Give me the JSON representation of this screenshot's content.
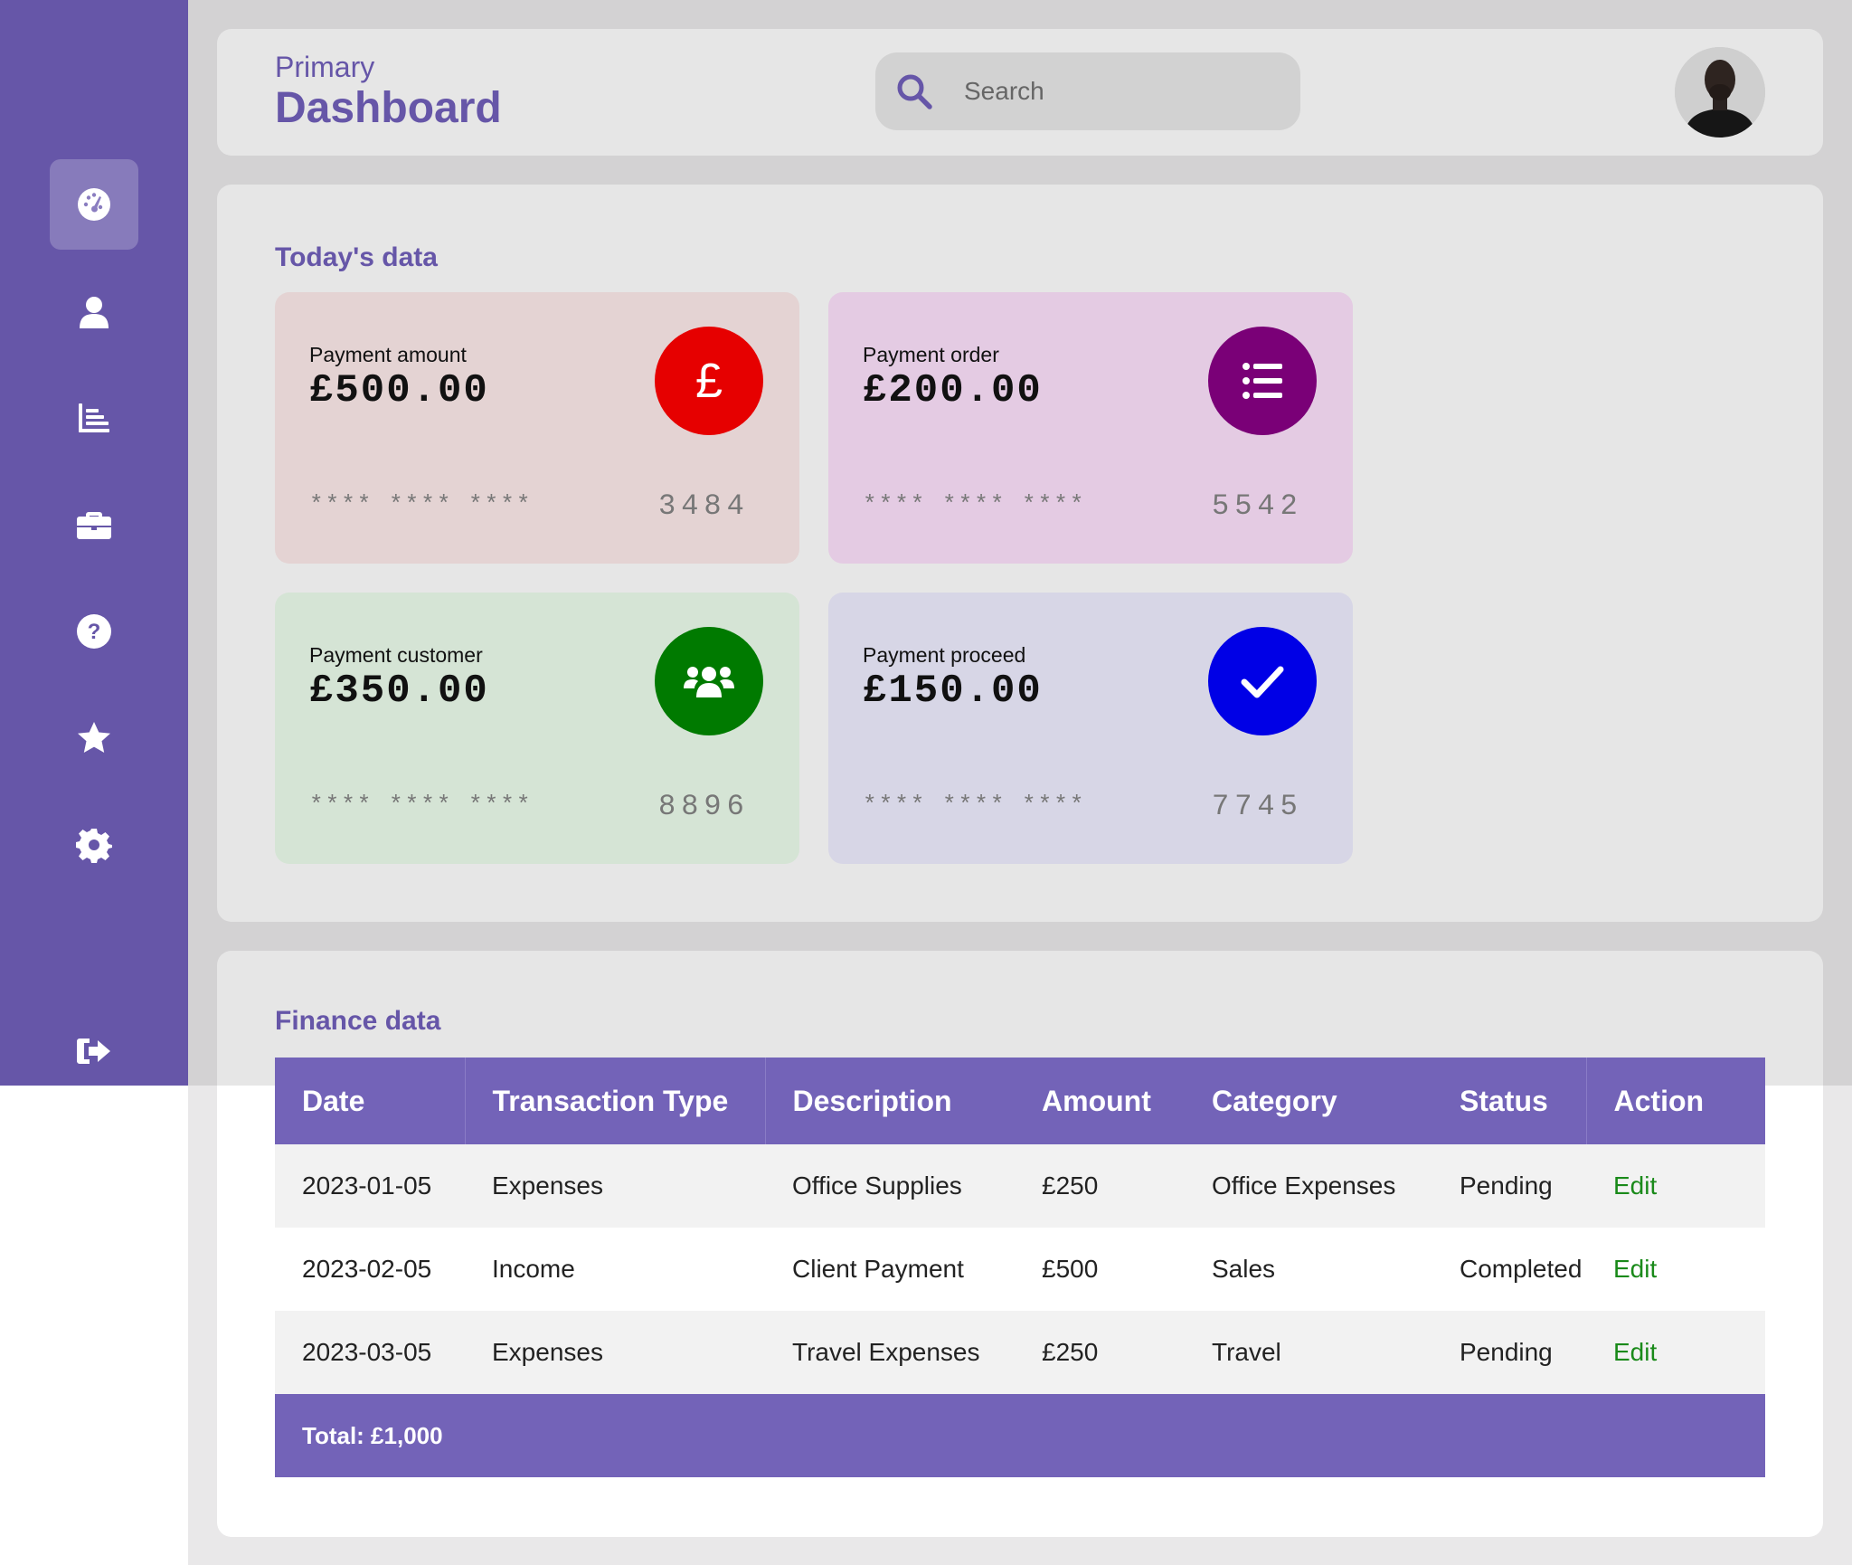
{
  "header": {
    "subtitle": "Primary",
    "title": "Dashboard",
    "search_placeholder": "Search"
  },
  "sidebar": {
    "items": [
      {
        "icon": "dashboard-gauge-icon",
        "active": true
      },
      {
        "icon": "user-icon"
      },
      {
        "icon": "bar-chart-icon"
      },
      {
        "icon": "briefcase-icon"
      },
      {
        "icon": "help-icon"
      },
      {
        "icon": "star-icon"
      },
      {
        "icon": "gear-icon"
      },
      {
        "icon": "logout-icon"
      }
    ]
  },
  "today": {
    "title": "Today's data",
    "cards": [
      {
        "label": "Payment amount",
        "value": "£500.00",
        "mask": "**** **** ****",
        "last4": "3484",
        "icon": "pound-icon",
        "bg": "#e4d3d3",
        "icon_color": "#e60000"
      },
      {
        "label": "Payment order",
        "value": "£200.00",
        "mask": "**** **** ****",
        "last4": "5542",
        "icon": "list-icon",
        "bg": "#e4cbe3",
        "icon_color": "#7a0077"
      },
      {
        "label": "Payment customer",
        "value": "£350.00",
        "mask": "**** **** ****",
        "last4": "8896",
        "icon": "users-icon",
        "bg": "#d5e4d5",
        "icon_color": "#007a00"
      },
      {
        "label": "Payment proceed",
        "value": "£150.00",
        "mask": "**** **** ****",
        "last4": "7745",
        "icon": "check-icon",
        "bg": "#d7d6e6",
        "icon_color": "#0000e6"
      }
    ]
  },
  "finance": {
    "title": "Finance data",
    "columns": [
      "Date",
      "Transaction Type",
      "Description",
      "Amount",
      "Category",
      "Status",
      "Action"
    ],
    "rows": [
      [
        "2023-01-05",
        "Expenses",
        "Office Supplies",
        "£250",
        "Office Expenses",
        "Pending",
        "Edit"
      ],
      [
        "2023-02-05",
        "Income",
        "Client Payment",
        "£500",
        "Sales",
        "Completed",
        "Edit"
      ],
      [
        "2023-03-05",
        "Expenses",
        "Travel Expenses",
        "£250",
        "Travel",
        "Pending",
        "Edit"
      ]
    ],
    "total": "Total: £1,000"
  },
  "colors": {
    "brand": "#6656a8",
    "table_header": "#7363b8",
    "edit_link": "#1a8a1a"
  }
}
